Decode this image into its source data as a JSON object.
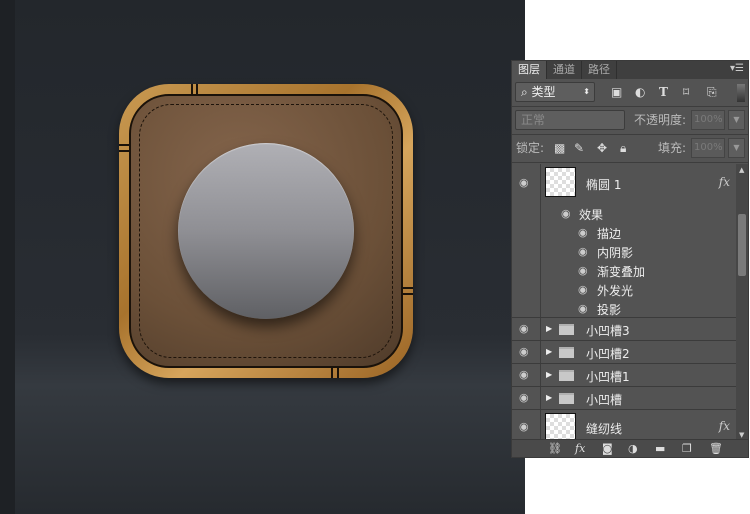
{
  "panel": {
    "tabs": [
      {
        "label": "图层",
        "active": true
      },
      {
        "label": "通道",
        "active": false
      },
      {
        "label": "路径",
        "active": false
      }
    ],
    "filter": {
      "label": "类型",
      "icons": [
        "image-filter-icon",
        "adjustment-filter-icon",
        "type-filter-icon",
        "shape-filter-icon",
        "smart-object-filter-icon"
      ]
    },
    "blend_mode": "正常",
    "opacity_label": "不透明度:",
    "opacity_value": "100%",
    "lock_label": "锁定:",
    "fill_label": "填充:",
    "fill_value": "100%",
    "layers": [
      {
        "name": "椭圆 1",
        "fx": "fx",
        "effects_label": "效果",
        "effects": [
          "描边",
          "内阴影",
          "渐变叠加",
          "外发光",
          "投影"
        ]
      },
      {
        "name": "小凹槽3",
        "type": "group"
      },
      {
        "name": "小凹槽2",
        "type": "group"
      },
      {
        "name": "小凹槽1",
        "type": "group"
      },
      {
        "name": "小凹槽",
        "type": "group"
      },
      {
        "name": "缝纫线",
        "fx": "fx"
      }
    ],
    "bottom_fx": "fx"
  }
}
